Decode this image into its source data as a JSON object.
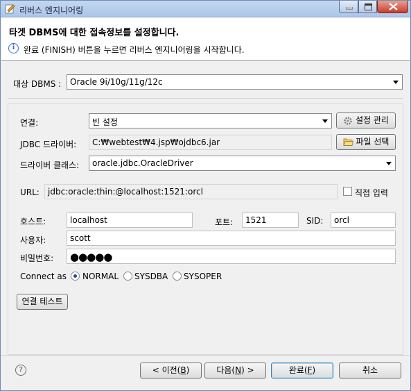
{
  "window": {
    "title": "리버스 엔지니어링"
  },
  "header": {
    "title": "타겟 DBMS에 대한 접속정보를 설정합니다.",
    "description": "완료 (FINISH) 버튼을 누르면 리버스 엔지니어링을 시작합니다."
  },
  "dbms": {
    "label": "대상 DBMS :",
    "selected": "Oracle 9i/10g/11g/12c"
  },
  "connection": {
    "label": "연결:",
    "selected": "빈 설정",
    "manage_button": "설정 관리"
  },
  "jdbc": {
    "label": "JDBC 드라이버:",
    "path": "C:₩webtest₩4.jsp₩ojdbc6.jar",
    "file_button": "파일 선택"
  },
  "driver_class": {
    "label": "드라이버 클래스:",
    "selected": "oracle.jdbc.OracleDriver"
  },
  "url": {
    "label": "URL:",
    "value": "jdbc:oracle:thin:@localhost:1521:orcl",
    "direct_input_label": "직접 입력",
    "direct_input_checked": false
  },
  "host": {
    "label": "호스트:",
    "value": "localhost"
  },
  "port": {
    "label": "포트:",
    "value": "1521"
  },
  "sid": {
    "label": "SID:",
    "value": "orcl"
  },
  "user": {
    "label": "사용자:",
    "value": "scott"
  },
  "password": {
    "label": "비밀번호:",
    "value": "●●●●●"
  },
  "connect_as": {
    "label": "Connect as",
    "options": [
      "NORMAL",
      "SYSDBA",
      "SYSOPER"
    ],
    "selected": "NORMAL"
  },
  "test_button": "연결 테스트",
  "footer": {
    "back_text": "< 이전(",
    "back_mnemonic": "B",
    "next_text": "다음(",
    "next_mnemonic": "N",
    "next_suffix": ") >",
    "finish_text": "완료(",
    "finish_mnemonic": "F",
    "close_paren": ")",
    "cancel": "취소"
  }
}
